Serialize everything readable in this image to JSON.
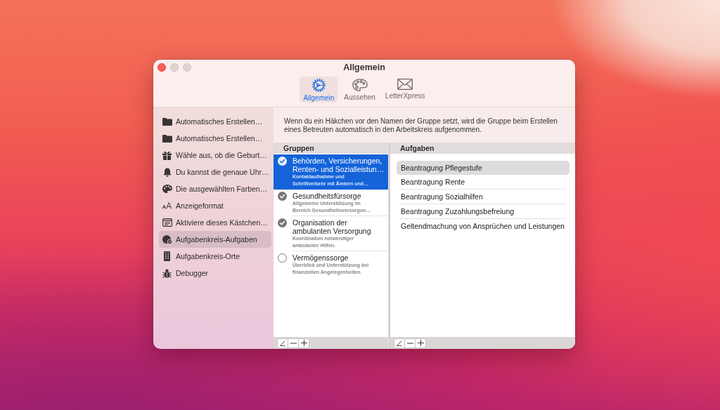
{
  "window": {
    "title": "Allgemein",
    "buttons": [
      {
        "kind": "close",
        "disabled": false
      },
      {
        "kind": "minimize",
        "disabled": true
      },
      {
        "kind": "zoom",
        "disabled": true
      }
    ]
  },
  "toolbar": {
    "tabs": [
      {
        "label": "Allgemein",
        "selected": true
      },
      {
        "label": "Aussehen",
        "selected": false
      },
      {
        "label": "LetterXpress",
        "selected": false
      }
    ]
  },
  "sidebar": {
    "items": [
      {
        "label": "Automatisches Erstellen…",
        "selected": false
      },
      {
        "label": "Automatisches Erstellen…",
        "selected": false
      },
      {
        "label": "Wähle aus, ob die Geburt…",
        "selected": false
      },
      {
        "label": "Du kannst die genaue Uhr…",
        "selected": false
      },
      {
        "label": "Die ausgewählten Farben…",
        "selected": false
      },
      {
        "label": "Anzeigeformat",
        "selected": false
      },
      {
        "label": "Aktiviere dieses Kästchen…",
        "selected": false
      },
      {
        "label": "Aufgabenkreis-Aufgaben",
        "selected": true
      },
      {
        "label": "Aufgabenkreis-Orte",
        "selected": false
      },
      {
        "label": "Debugger",
        "selected": false
      }
    ]
  },
  "description": "Wenn du ein Häkchen vor den Namen der Gruppe setzt, wird die Gruppe beim Erstellen eines Betreuten automatisch in den Arbeitskreis aufgenommen.",
  "groups": {
    "header": "Gruppen",
    "items": [
      {
        "title": "Behörden, Versicherungen, Renten- und Sozialleistun…",
        "subtitle": "Kontaktaufnahme und Schriftverkehr mit Ämtern und…",
        "checked": true,
        "selected": true
      },
      {
        "title": "Gesundheitsfürsorge",
        "subtitle": "Allgemeine Unterstützung im Bereich Gesundheitsversorgun…",
        "checked": true,
        "selected": false
      },
      {
        "title": "Organisation der ambulanten Versorgung",
        "subtitle": "Koordination notwendiger ambulanter Hilfen.",
        "checked": true,
        "selected": false
      },
      {
        "title": "Vermögenssorge",
        "subtitle": "Überblick und Unterstützung bei finanziellen Angelegenheiten.",
        "checked": false,
        "selected": false
      }
    ]
  },
  "tasks": {
    "header": "Aufgaben",
    "items": [
      {
        "label": "Beantragung Pflegestufe",
        "selected": true
      },
      {
        "label": "Beantragung Rente",
        "selected": false
      },
      {
        "label": "Beantragung Sozialhilfen",
        "selected": false
      },
      {
        "label": "Beantragung Zuzahlungsbefreiung",
        "selected": false
      },
      {
        "label": "Geltendmachung von Ansprüchen und Leistungen",
        "selected": false
      }
    ]
  }
}
